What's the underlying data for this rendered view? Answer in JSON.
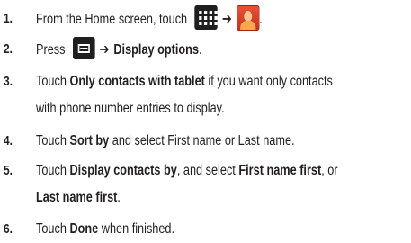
{
  "steps": [
    {
      "number": "1.",
      "pre": "From the Home screen, touch",
      "arrow": "➔",
      "post": "."
    },
    {
      "number": "2.",
      "pre": "Press",
      "arrow": "➔",
      "bold": "Display options",
      "post": "."
    },
    {
      "number": "3.",
      "pre": "Touch",
      "bold": "Only contacts with tablet",
      "post": "if you want only contacts",
      "line2": "with phone number entries to display."
    },
    {
      "number": "4.",
      "pre": "Touch",
      "bold": "Sort by",
      "post": "and select First name or Last name."
    },
    {
      "number": "5.",
      "pre": "Touch",
      "bold": "Display contacts by",
      "mid": ", and select",
      "bold2": "First name first",
      "post": ", or",
      "line2_bold": "Last name first",
      "line2_post": "."
    },
    {
      "number": "6.",
      "pre": "Touch",
      "bold": "Done",
      "post": "when finished."
    }
  ]
}
